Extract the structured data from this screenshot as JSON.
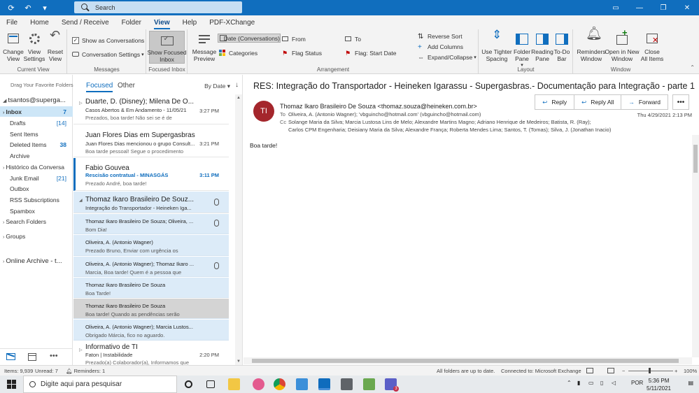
{
  "titlebar": {
    "search_placeholder": "Search"
  },
  "menu": {
    "tabs": [
      "File",
      "Home",
      "Send / Receive",
      "Folder",
      "View",
      "Help",
      "PDF-XChange"
    ],
    "active": "View"
  },
  "ribbon": {
    "current_view": {
      "label": "Current View",
      "change_view": "Change\nView",
      "view_settings": "View\nSettings",
      "reset_view": "Reset\nView"
    },
    "messages": {
      "label": "Messages",
      "show_as_conversations": "Show as Conversations",
      "conversation_settings": "Conversation Settings"
    },
    "focused_inbox": {
      "label": "Focused Inbox",
      "button": "Show Focused\nInbox"
    },
    "arrangement": {
      "label": "Arrangement",
      "message_preview": "Message\nPreview",
      "date_conversations": "Date (Conversations)",
      "from": "From",
      "to": "To",
      "categories": "Categories",
      "flag_status": "Flag Status",
      "flag_start_date": "Flag: Start Date",
      "reverse_sort": "Reverse Sort",
      "add_columns": "Add Columns",
      "expand_collapse": "Expand/Collapse"
    },
    "layout": {
      "label": "Layout",
      "use_tighter_spacing": "Use Tighter\nSpacing",
      "folder_pane": "Folder\nPane",
      "reading_pane": "Reading\nPane",
      "todo_bar": "To-Do\nBar"
    },
    "window": {
      "label": "Window",
      "reminders_window": "Reminders\nWindow",
      "open_new_window": "Open in New\nWindow",
      "close_all_items": "Close\nAll Items"
    }
  },
  "folders": {
    "drag_hint": "Drag Your Favorite Folders H",
    "account": "tsantos@superga...",
    "items": [
      {
        "name": "Inbox",
        "count": "7",
        "selected": true
      },
      {
        "name": "Drafts",
        "count": "[14]"
      },
      {
        "name": "Sent Items",
        "count": ""
      },
      {
        "name": "Deleted Items",
        "count": "38"
      },
      {
        "name": "Archive",
        "count": ""
      },
      {
        "name": "Histórico da Conversa",
        "count": ""
      },
      {
        "name": "Junk Email",
        "count": "[21]"
      },
      {
        "name": "Outbox",
        "count": ""
      },
      {
        "name": "RSS Subscriptions",
        "count": ""
      },
      {
        "name": "Spambox",
        "count": ""
      },
      {
        "name": "Search Folders",
        "count": ""
      }
    ],
    "groups": "Groups",
    "online_archive": "Online Archive - t..."
  },
  "list": {
    "tab_focused": "Focused",
    "tab_other": "Other",
    "sort": "By Date",
    "messages": [
      {
        "from": "Duarte, D. (Disney);  Milena De O...",
        "subject": "Casos Abertos & Em Andamento - 11/05/21",
        "preview": "Prezados, boa tarde!  Não sei se é de",
        "time": "3:27 PM"
      },
      {
        "from": "Juan Flores Dias em Supergasbras",
        "subject": "Juan Flores Dias mencionou o grupo Consult...",
        "preview": "Boa tarde pessoal! Segue o procedimento",
        "time": "3:21 PM"
      },
      {
        "from": "Fabio Gouvea",
        "subject": "Rescisão contratual  - MINASGÁS",
        "preview": "Prezado André, boa tarde!",
        "time": "3:11 PM"
      },
      {
        "from": "Thomaz Ikaro Brasileiro De Souz...",
        "subject": "Integração do Transportador - Heineken Iga...",
        "preview": "",
        "time": ""
      },
      {
        "from": "Informativo de TI",
        "subject": "Faton | Instabilidade",
        "preview": "Prezado(a) Colaborador(a),  Informamos que",
        "time": "2:20 PM"
      }
    ],
    "conversation": [
      {
        "from": "Thomaz Ikaro Brasileiro De Souza;  Oliveira, ...",
        "preview": "Bom Dia!"
      },
      {
        "from": "Oliveira, A. (Antonio Wagner)",
        "preview": "Prezado Bruno,  Enviar com urgência os"
      },
      {
        "from": "Oliveira, A. (Antonio Wagner);  Thomaz Ikaro ...",
        "preview": "Marcia,  Boa tarde!  Quem é a pessoa que"
      },
      {
        "from": "Thomaz Ikaro Brasileiro De Souza",
        "preview": "Boa Tarde!"
      },
      {
        "from": "Thomaz Ikaro Brasileiro De Souza",
        "preview": "Boa tarde!  Quando as pendências serão"
      },
      {
        "from": "Oliveira, A. (Antonio Wagner);  Marcia Lustos...",
        "preview": "Obrigado Márcia,   fico no aguardo."
      }
    ]
  },
  "reading": {
    "subject": "RES: Integração do Transportador - Heineken Igarassu - Supergasbras.- Documentação para Integração - parte 1",
    "avatar_initials": "TI",
    "from": "Thomaz Ikaro Brasileiro De Souza <thomaz.souza@heineken.com.br>",
    "to_label": "To",
    "to": "Oliveira, A. (Antonio Wagner); 'vbguincho@hotmail.com' (vbguincho@hotmail.com)",
    "cc_label": "Cc",
    "cc_line1": "Solange Maria da Silva; Marcia Lustosa Lins de Melo; Alexandre Martins Magno; Adriano Henrique de Medeiros; Batista, R. (Ray);",
    "cc_line2": "Carlos CPM Engenharia; Deisiany Maria da Silva; Alexandre França; Roberta Mendes Lima; Santos, T. (Tomas); Silva, J. (Jonathan Inacio)",
    "date": "Thu 4/29/2021 2:13 PM",
    "reply": "Reply",
    "reply_all": "Reply All",
    "forward": "Forward",
    "body": "Boa tarde!"
  },
  "status": {
    "items": "Items: 9,939",
    "unread": "Unread: 7",
    "reminders": "Reminders: 1",
    "folders_status": "All folders are up to date.",
    "connection": "Connected to: Microsoft Exchange",
    "zoom": "100%"
  },
  "taskbar": {
    "search": "Digite aqui para pesquisar",
    "lang": "POR",
    "time": "5:36 PM",
    "date": "5/11/2021",
    "notif": "3"
  }
}
